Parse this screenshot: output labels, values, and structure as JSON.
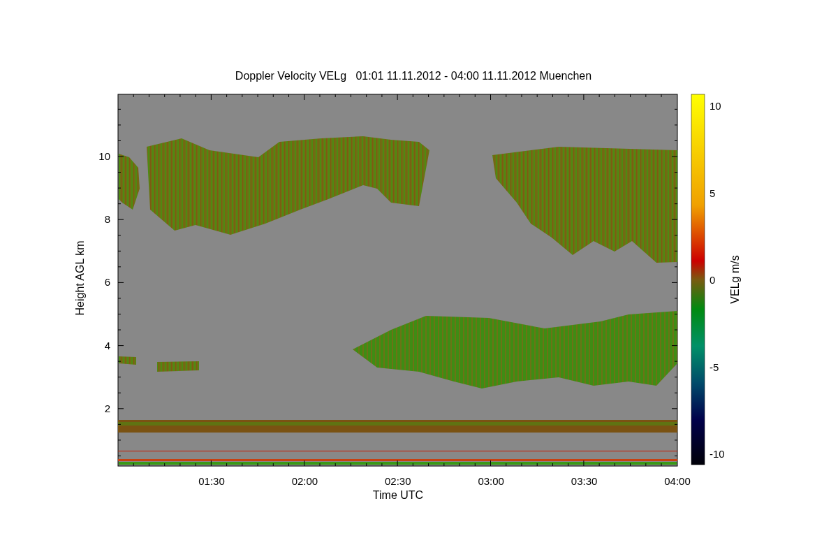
{
  "title": "Doppler Velocity VELg   01:01 11.11.2012 - 04:00 11.11.2012 Muenchen",
  "plot": {
    "xlabel": "Time UTC",
    "ylabel": "Height AGL km",
    "xticks": [
      "01:30",
      "02:00",
      "02:30",
      "03:00",
      "03:30",
      "04:00"
    ],
    "yticks": [
      "10",
      "8",
      "6",
      "4",
      "2"
    ]
  },
  "colorbar": {
    "label": "VELg m/s",
    "ticks": [
      "10",
      "5",
      "0",
      "-5",
      "-10"
    ]
  }
}
